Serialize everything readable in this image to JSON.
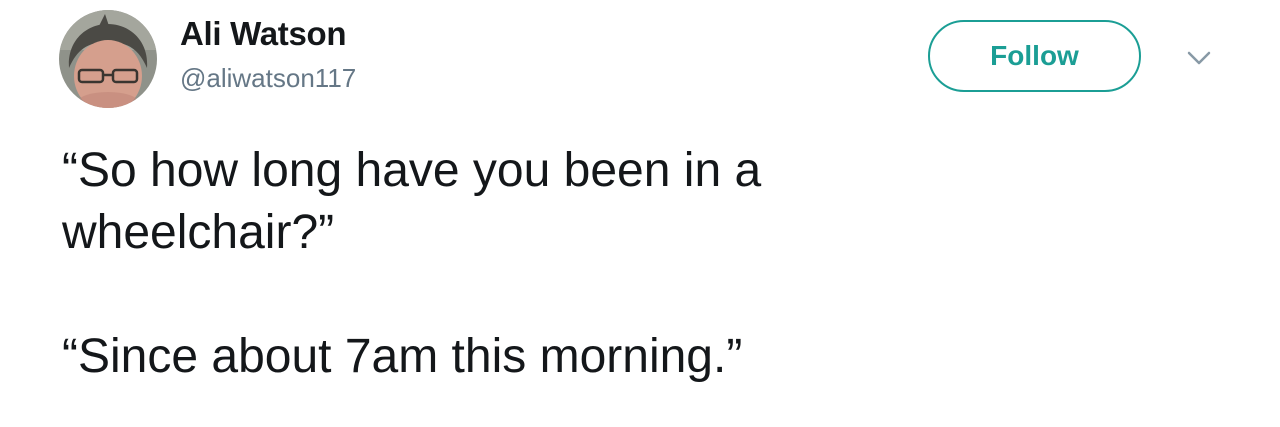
{
  "tweet": {
    "author": {
      "display_name": "Ali Watson",
      "handle": "@aliwatson117",
      "avatar_icon": "user-avatar-photo"
    },
    "follow_label": "Follow",
    "menu_icon": "chevron-down-icon",
    "text_lines": [
      "“So how long have you been in a",
      "wheelchair?”",
      "“Since about 7am this morning.”"
    ]
  },
  "colors": {
    "accent": "#1b9e95",
    "text": "#14171a",
    "muted": "#657786",
    "caret": "#8899a6"
  }
}
